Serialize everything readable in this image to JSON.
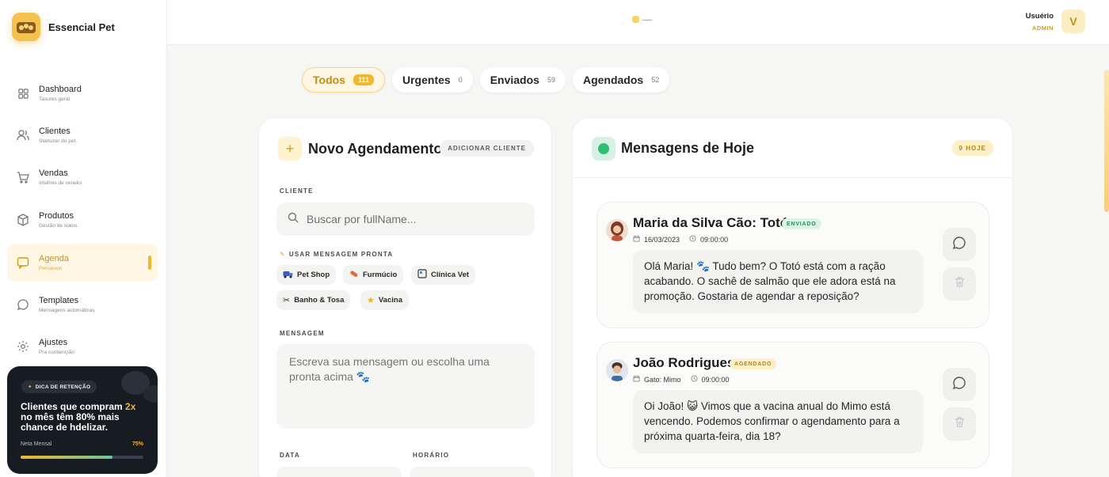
{
  "brand": {
    "name": "Essencial Pet"
  },
  "nav": [
    {
      "label": "Dashboard",
      "sub": "Tasures geral",
      "icon": "grid-icon"
    },
    {
      "label": "Clientes",
      "sub": "Startuzer do pet.",
      "icon": "users-icon"
    },
    {
      "label": "Vendas",
      "sub": "Intahnis de veneks",
      "icon": "cart-icon"
    },
    {
      "label": "Produtos",
      "sub": "Gestão de sialos",
      "icon": "box-icon"
    },
    {
      "label": "Agenda",
      "sub": "Penseoon",
      "icon": "chat-icon",
      "active": true
    },
    {
      "label": "Templates",
      "sub": "Mensagens automáticas",
      "icon": "message-icon"
    },
    {
      "label": "Ajustes",
      "sub": "Pra contiençião",
      "icon": "gear-icon"
    }
  ],
  "tip": {
    "badge": "DICA DE RETENÇÃO",
    "text_before": "Clientes que compram ",
    "highlight": "2x",
    "text_after": " no mês têm 80% mais chance de hdelizar.",
    "meta_label": "Neta Mensal",
    "meta_value": "75%",
    "progress": 0.75
  },
  "header": {
    "user_name": "Usuério",
    "user_role": "ADMIN",
    "avatar_letter": "V"
  },
  "filters": [
    {
      "label": "Todos",
      "count": "111",
      "active": true
    },
    {
      "label": "Urgentes",
      "count": "0"
    },
    {
      "label": "Enviados",
      "count": "59"
    },
    {
      "label": "Agendados",
      "count": "52"
    }
  ],
  "new_schedule": {
    "title": "Novo Agendamento",
    "add_client": "ADICIONAR CLIENTE",
    "client_label": "CLIENTE",
    "search_placeholder": "Buscar por fullName...",
    "ready_label": "USAR MENSAGEM PRONTA",
    "chips": [
      {
        "label": "Pet Shop",
        "icon": "truck-icon"
      },
      {
        "label": "Furmúcio",
        "icon": "pill-icon"
      },
      {
        "label": "Clínica Vet",
        "icon": "clinic-icon"
      },
      {
        "label": "Banho & Tosa",
        "icon": "scissors-icon"
      },
      {
        "label": "Vacina",
        "icon": "star-icon"
      }
    ],
    "message_label": "MENSAGEM",
    "message_placeholder": "Escreva sua mensagem ou escolha uma pronta acima 🐾",
    "date_label": "DATA",
    "time_label": "HORÁRIO"
  },
  "messages_panel": {
    "title": "Mensagens de Hoje",
    "today_badge": "9 HOJE",
    "items": [
      {
        "name": "Maria da Silva  Cão: Totó",
        "status": "ENVIADO",
        "date": "16/03/2023",
        "time": "09:00:00",
        "text": "Olá Maria! 🐾 Tudo bem? O Totó está com a ração acabando. O sachê de salmão que ele adora está na promoção. Gostaria de agendar a reposição?"
      },
      {
        "name": "João Rodrigues",
        "status": "AGENDADO",
        "date": "Gato: Mimo",
        "time": "09:00:00",
        "text": "Oi João! 😺 Vimos que a vacina anual do Mimo está vencendo. Podemos confirmar o agendamento para a próxima quarta-feira, dia 18?"
      }
    ]
  },
  "colors": {
    "accent": "#f2b631",
    "success": "#2fbf71",
    "dark": "#171c23"
  }
}
